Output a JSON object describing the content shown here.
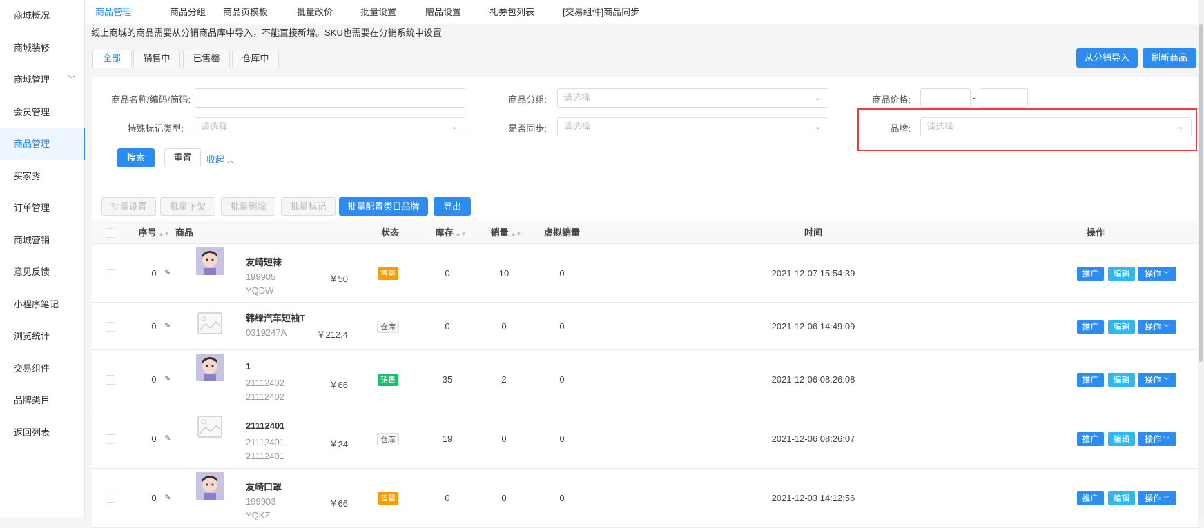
{
  "sidebar": {
    "items": [
      "商城概况",
      "商城装修",
      "商城管理",
      "会员管理",
      "商品管理",
      "买家秀",
      "订单管理",
      "商城营销",
      "意见反馈",
      "小程序笔记",
      "浏览统计",
      "交易组件",
      "品牌类目",
      "返回列表"
    ],
    "active": 4
  },
  "topnav": [
    "商品管理",
    "商品分组",
    "商品页模板",
    "批量改价",
    "批量设置",
    "赠品设置",
    "礼券包列表",
    "[交易组件]商品同步"
  ],
  "notice": "线上商城的商品需要从分销商品库中导入，不能直接新增。SKU也需要在分销系统中设置",
  "status_tabs": [
    "全部",
    "销售中",
    "已售罄",
    "仓库中"
  ],
  "actions": {
    "import": "从分销导入",
    "refresh": "刷新商品"
  },
  "filters": {
    "name_label": "商品名称/编码/简码:",
    "name_value": "",
    "group_label": "商品分组:",
    "price_label": "商品价格:",
    "price_sep": "-",
    "mark_label": "特殊标记类型:",
    "sync_label": "是否同步:",
    "brand_label": "品牌:",
    "placeholder": "请选择",
    "search": "搜索",
    "reset": "重置",
    "collapse": "收起"
  },
  "bulk": [
    "批量设置",
    "批量下架",
    "批量删除",
    "批量标记",
    "批量配置类目品牌",
    "导出"
  ],
  "table": {
    "headers": {
      "seq": "序号",
      "product": "商品",
      "status": "状态",
      "stock": "库存",
      "sales": "销量",
      "virtual": "虚拟销量",
      "time": "时间",
      "ops": "操作"
    },
    "rows": [
      {
        "seq": "0",
        "name": "友崎短袜",
        "code1": "199905",
        "code2": "YQDW",
        "price": "￥50",
        "status": "售罄",
        "stock": "0",
        "sales": "10",
        "virtual": "0",
        "time": "2021-12-07 15:54:39",
        "img": "photo"
      },
      {
        "seq": "0",
        "name": "韩绿汽车短袖T",
        "code1": "0319247A",
        "code2": "",
        "price": "￥212.4",
        "status": "仓库",
        "stock": "0",
        "sales": "0",
        "virtual": "0",
        "time": "2021-12-06 14:49:09",
        "img": "placeholder"
      },
      {
        "seq": "0",
        "name": "1",
        "code1": "21112402",
        "code2": "21112402",
        "price": "￥66",
        "status": "销售",
        "stock": "35",
        "sales": "2",
        "virtual": "0",
        "time": "2021-12-06 08:26:08",
        "img": "photo"
      },
      {
        "seq": "0",
        "name": "21112401",
        "code1": "21112401",
        "code2": "21112401",
        "price": "￥24",
        "status": "仓库",
        "stock": "19",
        "sales": "0",
        "virtual": "0",
        "time": "2021-12-06 08:26:07",
        "img": "placeholder"
      },
      {
        "seq": "0",
        "name": "友崎口罩",
        "code1": "199903",
        "code2": "YQKZ",
        "price": "￥66",
        "status": "售罄",
        "stock": "0",
        "sales": "0",
        "virtual": "0",
        "time": "2021-12-03 14:12:56",
        "img": "photo"
      }
    ],
    "row_buttons": {
      "promote": "推广",
      "edit": "编辑",
      "more": "操作"
    }
  },
  "colors": {
    "primary": "#2d8cf0",
    "sold_out": "#ff9900",
    "on_sale": "#19be6b",
    "edit": "#2db7f5",
    "highlight": "#f23b3b"
  }
}
